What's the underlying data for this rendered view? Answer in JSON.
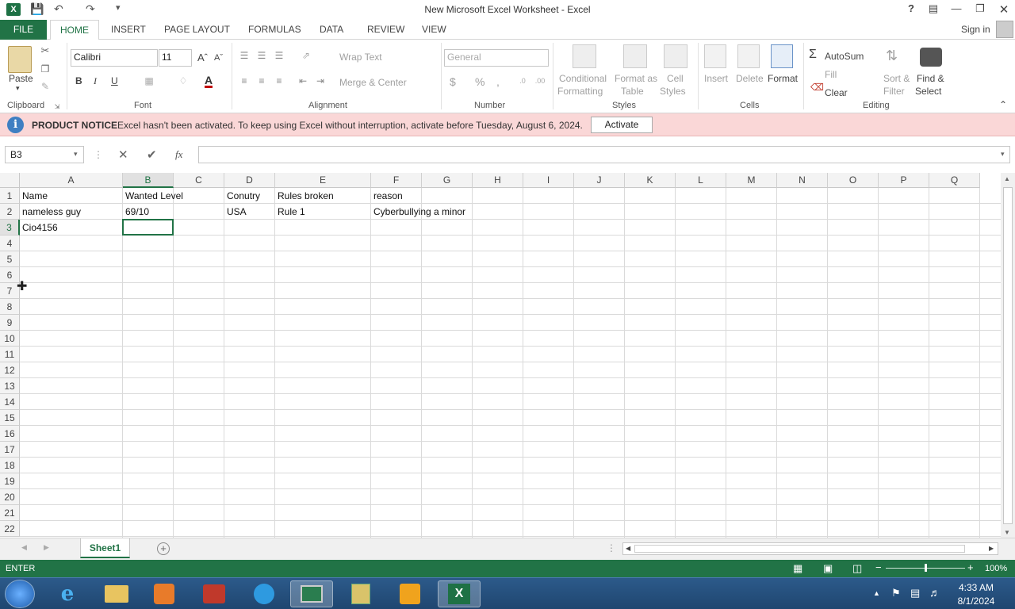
{
  "window": {
    "title": "New Microsoft Excel Worksheet - Excel",
    "help": "?",
    "sign_in": "Sign in"
  },
  "tabs": [
    "FILE",
    "HOME",
    "INSERT",
    "PAGE LAYOUT",
    "FORMULAS",
    "DATA",
    "REVIEW",
    "VIEW"
  ],
  "ribbon": {
    "clipboard": {
      "paste": "Paste",
      "label": "Clipboard"
    },
    "font": {
      "name": "Calibri",
      "size": "11",
      "bold": "B",
      "italic": "I",
      "underline": "U",
      "label": "Font"
    },
    "alignment": {
      "wrap": "Wrap Text",
      "merge": "Merge & Center",
      "label": "Alignment"
    },
    "number": {
      "format": "General",
      "currency": "$",
      "percent": "%",
      "comma": ",",
      "label": "Number"
    },
    "styles": {
      "conditional": "Conditional",
      "conditional2": "Formatting",
      "format_as": "Format as",
      "format_as2": "Table",
      "cell": "Cell",
      "cell2": "Styles",
      "label": "Styles"
    },
    "cells": {
      "insert": "Insert",
      "delete": "Delete",
      "format": "Format",
      "label": "Cells"
    },
    "editing": {
      "autosum": "AutoSum",
      "fill": "Fill",
      "clear": "Clear",
      "sort": "Sort &",
      "sort2": "Filter",
      "find": "Find &",
      "find2": "Select",
      "label": "Editing"
    }
  },
  "notice": {
    "heading": "PRODUCT NOTICE",
    "message": "Excel hasn't been activated. To keep using Excel without interruption, activate before Tuesday, August 6, 2024.",
    "button": "Activate"
  },
  "formula_bar": {
    "name_box": "B3",
    "fx": "fx",
    "value": ""
  },
  "columns": [
    "A",
    "B",
    "C",
    "D",
    "E",
    "F",
    "G",
    "H",
    "I",
    "J",
    "K",
    "L",
    "M",
    "N",
    "O",
    "P",
    "Q"
  ],
  "rows": [
    "1",
    "2",
    "3",
    "4",
    "5",
    "6",
    "7",
    "8",
    "9",
    "10",
    "11",
    "12",
    "13",
    "14",
    "15",
    "16",
    "17",
    "18",
    "19",
    "20",
    "21",
    "22"
  ],
  "cells": {
    "A1": "Name",
    "B1": "Wanted Level",
    "D1": "Conutry",
    "E1": "Rules broken",
    "F1": "reason",
    "A2": "nameless guy",
    "B2": "69/10",
    "D2": "USA",
    "E2": "Rule 1",
    "F2": "Cyberbullying a minor",
    "A3": "Cio4156"
  },
  "sheet": {
    "tab": "Sheet1"
  },
  "status": {
    "mode": "ENTER",
    "zoom": "100%"
  },
  "taskbar": {
    "time": "4:33 AM",
    "date": "8/1/2024"
  },
  "colors": {
    "excel_green": "#217346",
    "notice_bg": "#fad7d7",
    "taskbar": "#1f4670"
  }
}
